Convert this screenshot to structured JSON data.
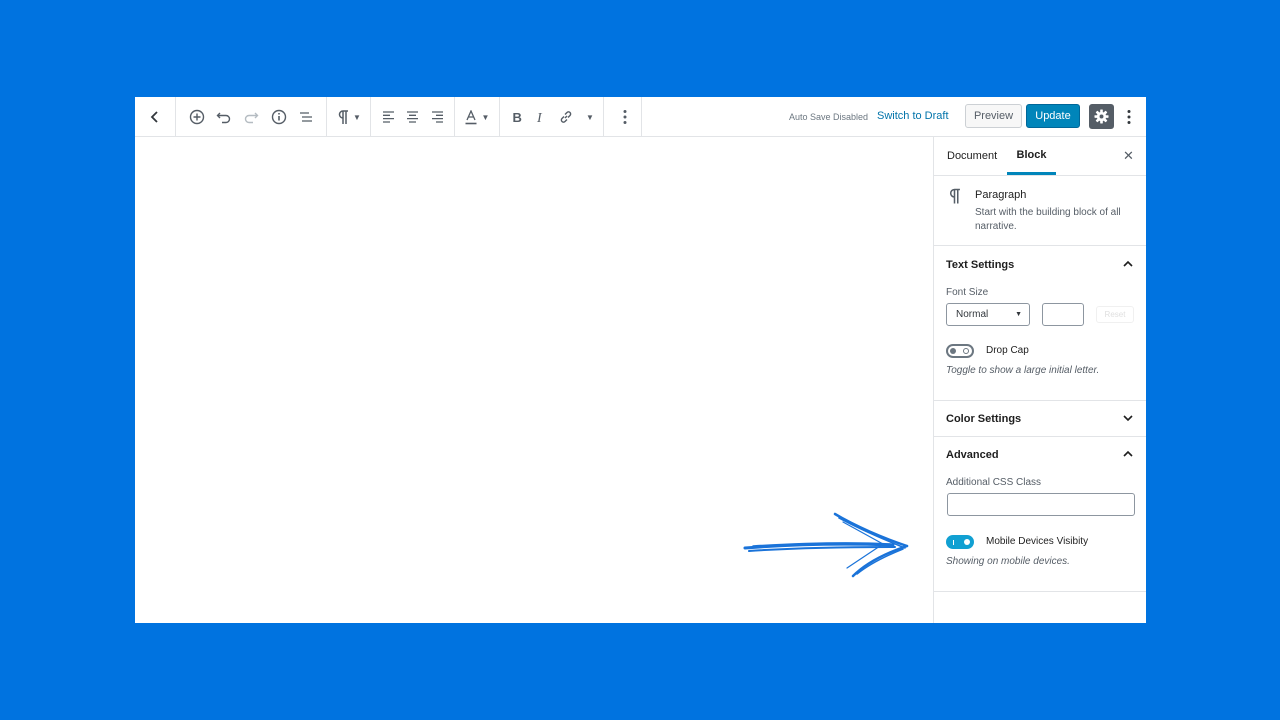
{
  "toolbar": {
    "autosave_text": "Auto Save Disabled",
    "switch_draft_label": "Switch to Draft",
    "preview_label": "Preview",
    "update_label": "Update",
    "icons": [
      "back-chevron-icon",
      "add-block-icon",
      "undo-icon",
      "redo-icon",
      "info-icon",
      "outline-icon",
      "paragraph-icon",
      "align-left-icon",
      "align-center-icon",
      "align-right-icon",
      "text-color-icon",
      "bold-icon",
      "italic-icon",
      "link-icon",
      "more-vertical-icon",
      "gear-icon"
    ]
  },
  "sidebar": {
    "tabs": [
      {
        "label": "Document"
      },
      {
        "label": "Block",
        "active": true
      }
    ],
    "block": {
      "title": "Paragraph",
      "description": "Start with the building block of all narrative."
    },
    "text_settings": {
      "title": "Text Settings",
      "font_size_label": "Font Size",
      "font_size_value": "Normal",
      "reset_label": "Reset",
      "drop_cap_label": "Drop Cap",
      "drop_cap_help": "Toggle to show a large initial letter.",
      "drop_cap_on": false
    },
    "color_settings": {
      "title": "Color Settings"
    },
    "advanced": {
      "title": "Advanced",
      "css_class_label": "Additional CSS Class",
      "mobile_label": "Mobile Devices Visibity",
      "mobile_help": "Showing on mobile devices.",
      "mobile_on": true
    }
  },
  "colors": {
    "background": "#0073e0",
    "accent": "#0085ba",
    "toggle_on": "#11a0d2",
    "arrow": "#1a73d9"
  }
}
